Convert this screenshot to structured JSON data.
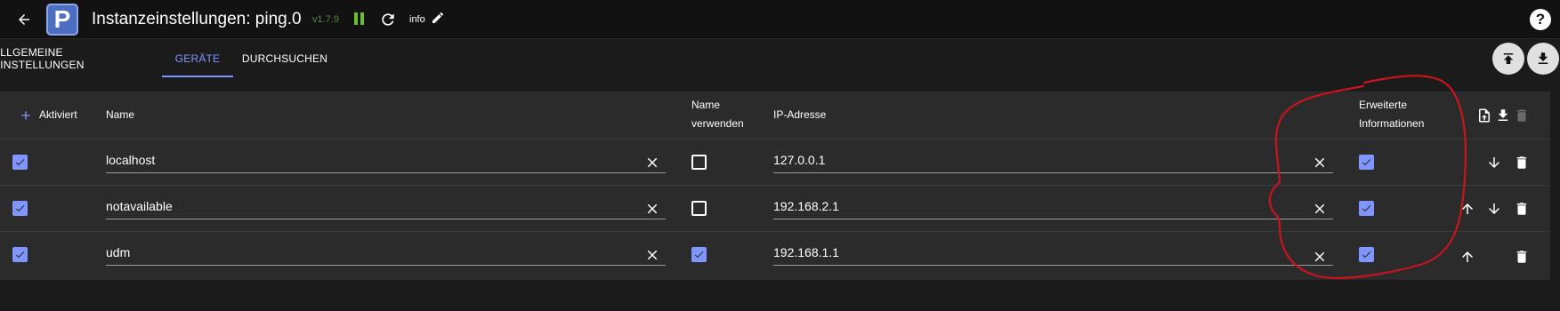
{
  "appbar": {
    "title": "Instanzeinstellungen: ping.0",
    "version": "v1.7.9",
    "info_label": "info",
    "logo_letter": "P",
    "help_label": "?"
  },
  "tabs": [
    {
      "label": "ALLGEMEINE EINSTELLUNGEN",
      "active": false
    },
    {
      "label": "GERÄTE",
      "active": true
    },
    {
      "label": "DURCHSUCHEN",
      "active": false
    }
  ],
  "table": {
    "headers": {
      "enabled": "Aktiviert",
      "name": "Name",
      "use_name_line1": "Name",
      "use_name_line2": "verwenden",
      "ip": "IP-Adresse",
      "extended_line1": "Erweiterte",
      "extended_line2": "Informationen"
    },
    "rows": [
      {
        "enabled": true,
        "name": "localhost",
        "use_name": false,
        "ip": "127.0.0.1",
        "extended": true,
        "can_move_up": false,
        "can_move_down": true
      },
      {
        "enabled": true,
        "name": "notavailable",
        "use_name": false,
        "ip": "192.168.2.1",
        "extended": true,
        "can_move_up": true,
        "can_move_down": true
      },
      {
        "enabled": true,
        "name": "udm",
        "use_name": true,
        "ip": "192.168.1.1",
        "extended": true,
        "can_move_up": true,
        "can_move_down": false
      }
    ]
  },
  "colors": {
    "accent": "#7f96ff",
    "annotation": "#c8141e",
    "background": "#1b1b1b",
    "table_bg": "#2b2b2b",
    "version": "#4f8a39"
  }
}
